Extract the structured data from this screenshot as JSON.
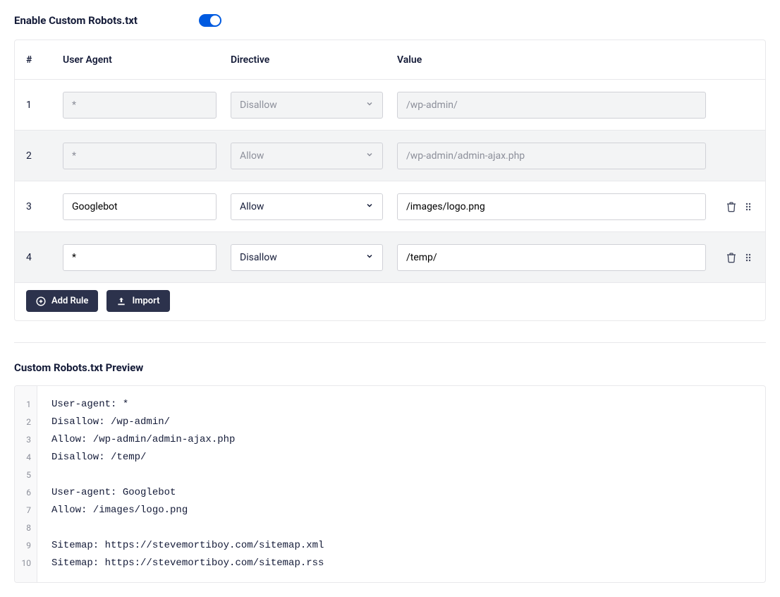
{
  "header": {
    "enable_label": "Enable Custom Robots.txt"
  },
  "table": {
    "headers": {
      "num": "#",
      "user_agent": "User Agent",
      "directive": "Directive",
      "value": "Value"
    },
    "rows": [
      {
        "num": "1",
        "user_agent": "",
        "user_agent_placeholder": "*",
        "directive": "Disallow",
        "value": "",
        "value_placeholder": "/wp-admin/",
        "disabled": true,
        "actions": false
      },
      {
        "num": "2",
        "user_agent": "",
        "user_agent_placeholder": "*",
        "directive": "Allow",
        "value": "",
        "value_placeholder": "/wp-admin/admin-ajax.php",
        "disabled": true,
        "actions": false
      },
      {
        "num": "3",
        "user_agent": "Googlebot",
        "user_agent_placeholder": "",
        "directive": "Allow",
        "value": "/images/logo.png",
        "value_placeholder": "",
        "disabled": false,
        "actions": true
      },
      {
        "num": "4",
        "user_agent": "*",
        "user_agent_placeholder": "",
        "directive": "Disallow",
        "value": "/temp/",
        "value_placeholder": "",
        "disabled": false,
        "actions": true
      }
    ]
  },
  "buttons": {
    "add_rule": "Add Rule",
    "import": "Import"
  },
  "preview": {
    "label": "Custom Robots.txt Preview",
    "lines": [
      "User-agent: *",
      "Disallow: /wp-admin/",
      "Allow: /wp-admin/admin-ajax.php",
      "Disallow: /temp/",
      "",
      "User-agent: Googlebot",
      "Allow: /images/logo.png",
      "",
      "Sitemap: https://stevemortiboy.com/sitemap.xml",
      "Sitemap: https://stevemortiboy.com/sitemap.rss"
    ]
  }
}
